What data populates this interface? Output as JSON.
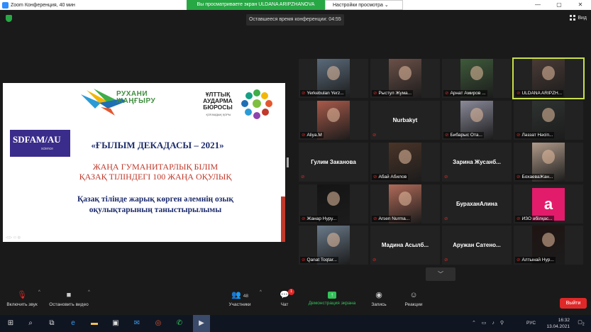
{
  "window": {
    "title": "Zoom Конференция, 40 мин",
    "controls": [
      "—",
      "▢",
      "✕"
    ]
  },
  "viewing_banner": {
    "text": "Вы просматриваете экран ULDANA ARIPZHANOVA",
    "options_label": "Настройки просмотра ⌄"
  },
  "meeting": {
    "time_left": "Оставшееся время конференции: 04:55",
    "view_label": "Вид"
  },
  "slide": {
    "rukhani_line1": "РУХАНИ",
    "rukhani_line2": "ЖАҢҒЫРУ",
    "org_line1": "ҰЛТТЫҚ",
    "org_line2": "АУДАРМА",
    "org_line3": "БЮРОСЫ",
    "org_sub": "ҚОҒАМДЫҚ ҚОРЫ",
    "sdf_logo": "SDFAM/AU",
    "sdf_sub": "science",
    "decade_title": "«ҒЫЛЫМ ДЕКАДАСЫ – 2021»",
    "red_line1": "ЖАҢА ГУМАНИТАРЛЫҚ БІЛІМ",
    "red_line2": "ҚАЗАҚ ТІЛІНДЕГІ 100 ЖАҢА ОҚУЛЫҚ",
    "blue_line1": "Қазақ тілінде жарық көрген әлемнің озық",
    "blue_line2": "оқулықтарының таныстырылымы"
  },
  "participants": [
    {
      "name": "Yerkebulan Yerz...",
      "muted": true,
      "video": true,
      "tone": "#5a6a7a"
    },
    {
      "name": "Рыстул Жума...",
      "muted": true,
      "video": true,
      "tone": "#6b5048"
    },
    {
      "name": "Арнат Амиров ...",
      "muted": true,
      "video": true,
      "tone": "#3e5a3a"
    },
    {
      "name": "ULDANA ARIPZH...",
      "muted": true,
      "video": true,
      "tone": "#4a3b36",
      "active": true
    },
    {
      "name": "Aliya.M",
      "muted": true,
      "video": true,
      "tone": "#a85a4a"
    },
    {
      "name": "Nurbakyt",
      "muted": true,
      "video": false
    },
    {
      "name": "Бибарыс Ота...",
      "muted": true,
      "video": true,
      "tone": "#8a8a9a"
    },
    {
      "name": "Ләззат Нәсіп...",
      "muted": true,
      "video": true,
      "tone": "#2e3330"
    },
    {
      "name": "Гулим Заканова",
      "muted": true,
      "video": false
    },
    {
      "name": "Абай Абилов",
      "muted": true,
      "video": true,
      "tone": "#4a3428"
    },
    {
      "name": "Зарина Жусанб...",
      "muted": true,
      "video": false
    },
    {
      "name": "БохаеваЖан...",
      "muted": true,
      "video": true,
      "tone": "#b09a8a"
    },
    {
      "name": "Жанар Нуру...",
      "muted": true,
      "video": true,
      "tone": "#141414"
    },
    {
      "name": "Arsen Nurma...",
      "muted": true,
      "video": true,
      "tone": "#b06a58"
    },
    {
      "name": "БураханАлина",
      "muted": true,
      "video": false
    },
    {
      "name": "ИЗО әбілқас...",
      "muted": true,
      "video": false,
      "avatar_letter": "a"
    },
    {
      "name": "Qanat Toqtar...",
      "muted": true,
      "video": true,
      "tone": "#6a7a8a"
    },
    {
      "name": "Мадина  Асылб...",
      "muted": true,
      "video": false
    },
    {
      "name": "Аружан  Сатено...",
      "muted": true,
      "video": false
    },
    {
      "name": "Алтынай Нур...",
      "muted": true,
      "video": true,
      "tone": "#1e1412"
    }
  ],
  "gallery": {
    "next_page_icon": "chevron-down-icon"
  },
  "toolbar": {
    "audio_label": "Включить звук",
    "video_label": "Остановить видео",
    "participants_label": "Участники",
    "participants_count": "48",
    "chat_label": "Чат",
    "chat_badge": "1",
    "share_label": "Демонстрация экрана",
    "record_label": "Запись",
    "reactions_label": "Реакции",
    "leave_label": "Выйти"
  },
  "taskbar": {
    "time": "16:32",
    "date": "13.04.2021",
    "lang": "РУС",
    "notifications": "2"
  },
  "colors": {
    "active_speaker": "#c9e04a",
    "leave_red": "#e02828",
    "share_green": "#32c35a",
    "banner_green": "#28a745",
    "zoom_blue": "#2d8cff"
  }
}
